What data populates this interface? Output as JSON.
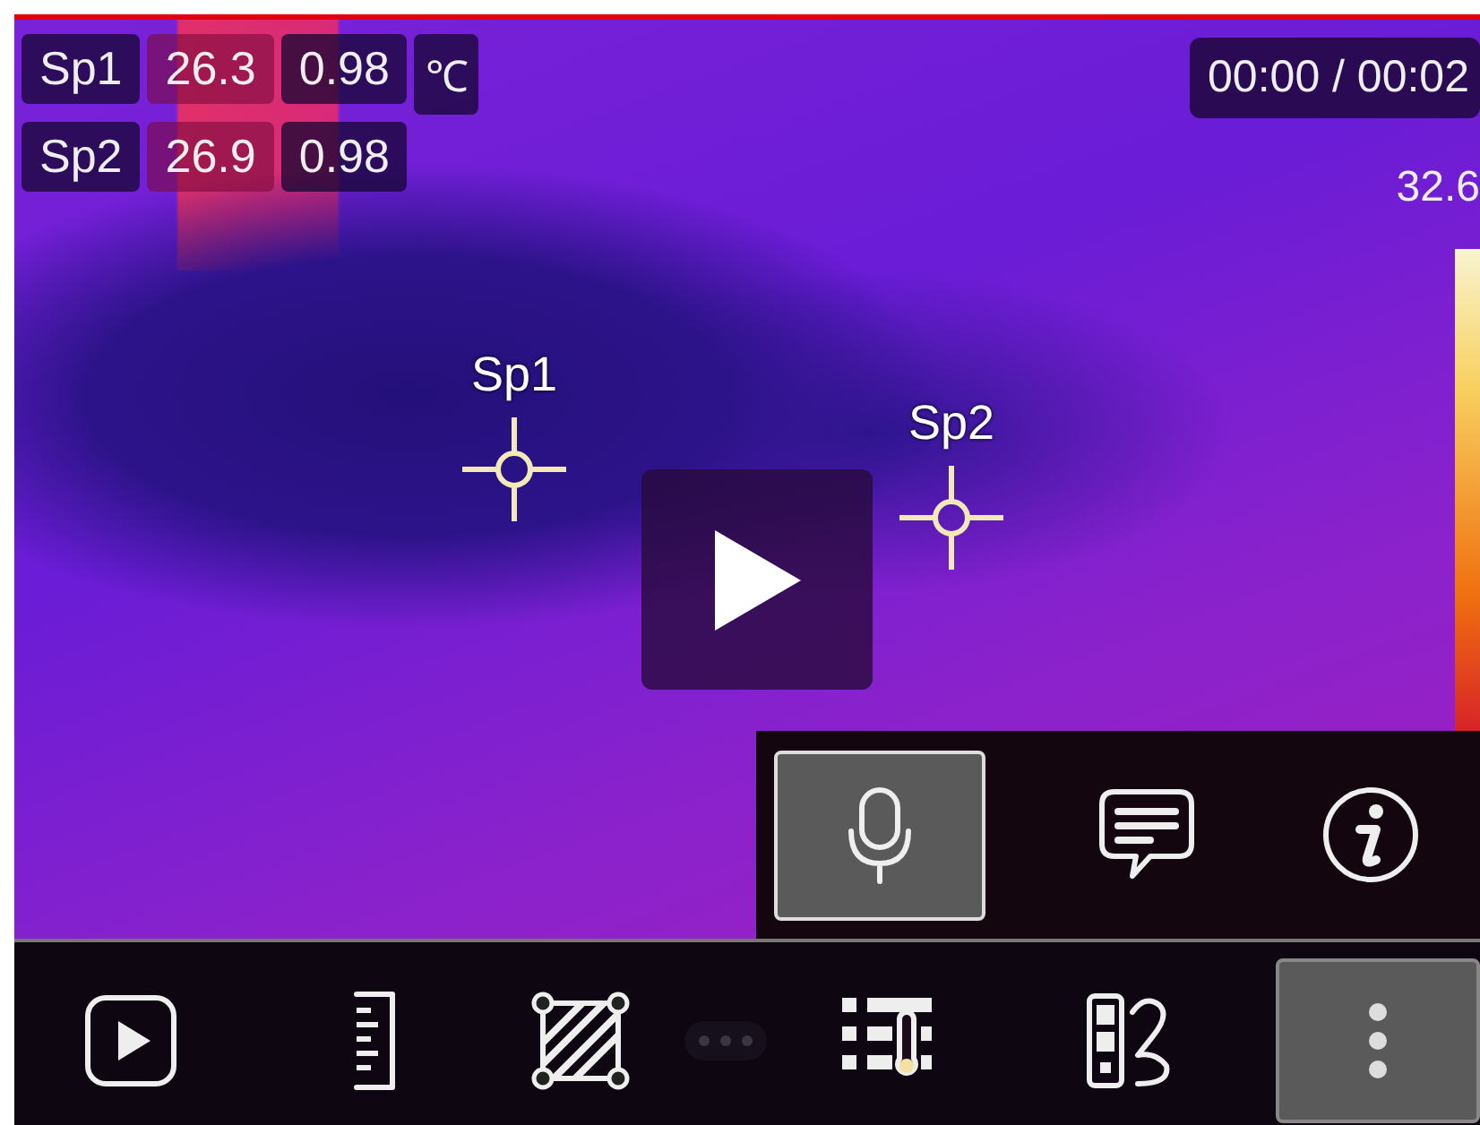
{
  "readings": [
    {
      "label": "Sp1",
      "temperature": "26.3",
      "emissivity": "0.98"
    },
    {
      "label": "Sp2",
      "temperature": "26.9",
      "emissivity": "0.98"
    }
  ],
  "unit": "℃",
  "playback_time": "00:00 / 00:02",
  "scale_max": "32.6",
  "spots": [
    {
      "label": "Sp1"
    },
    {
      "label": "Sp2"
    }
  ],
  "tools_panel": [
    {
      "kind": "mic",
      "selected": true
    },
    {
      "kind": "comment",
      "selected": false
    },
    {
      "kind": "info",
      "selected": false
    }
  ],
  "toolbar": [
    {
      "kind": "play",
      "selected": false
    },
    {
      "kind": "ruler",
      "selected": false
    },
    {
      "kind": "region",
      "selected": false
    },
    {
      "kind": "pager",
      "selected": false
    },
    {
      "kind": "thermo-list",
      "selected": false
    },
    {
      "kind": "palette-edit",
      "selected": false
    },
    {
      "kind": "more",
      "selected": true
    }
  ]
}
